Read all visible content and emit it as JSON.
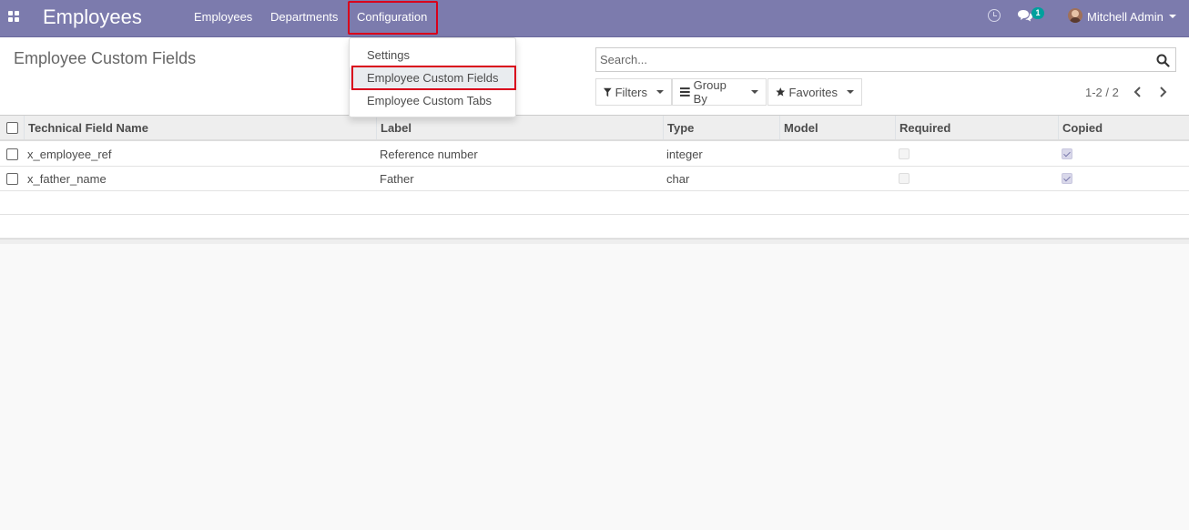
{
  "navbar": {
    "brand": "Employees",
    "menu": [
      {
        "label": "Employees"
      },
      {
        "label": "Departments"
      },
      {
        "label": "Configuration"
      }
    ],
    "chat_badge": "1",
    "user_name": "Mitchell Admin"
  },
  "dropdown": {
    "items": [
      {
        "label": "Settings"
      },
      {
        "label": "Employee Custom Fields"
      },
      {
        "label": "Employee Custom Tabs"
      }
    ]
  },
  "control_panel": {
    "title": "Employee Custom Fields",
    "search_placeholder": "Search...",
    "filters_label": "Filters",
    "groupby_label": "Group By",
    "favorites_label": "Favorites",
    "pager": "1-2 / 2"
  },
  "table": {
    "columns": [
      "Technical Field Name",
      "Label",
      "Type",
      "Model",
      "Required",
      "Copied"
    ],
    "rows": [
      {
        "technical_name": "x_employee_ref",
        "label": "Reference number",
        "type": "integer",
        "model": "",
        "required": false,
        "copied": true
      },
      {
        "technical_name": "x_father_name",
        "label": "Father",
        "type": "char",
        "model": "",
        "required": false,
        "copied": true
      }
    ]
  },
  "colors": {
    "navbar": "#7c7bad",
    "highlight": "#d9001b",
    "badge": "#00a09d"
  }
}
